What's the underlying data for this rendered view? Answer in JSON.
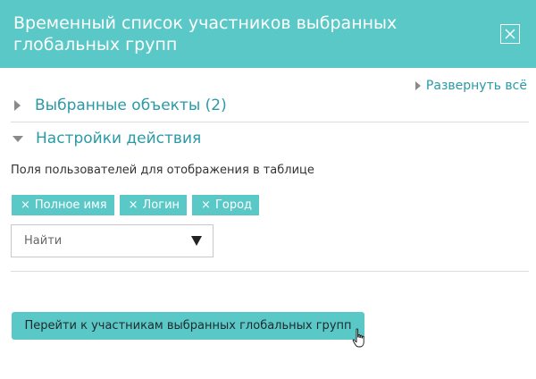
{
  "header": {
    "title": "Временный список участников выбранных глобальных групп"
  },
  "toolbar": {
    "expand_all_label": "Развернуть всё"
  },
  "sections": [
    {
      "label": "Выбранные объекты (2)",
      "expanded": false
    },
    {
      "label": "Настройки действия",
      "expanded": true
    }
  ],
  "settings": {
    "fields_label": "Поля пользователей для отображения в таблице",
    "tags": [
      {
        "label": "Полное имя"
      },
      {
        "label": "Логин"
      },
      {
        "label": "Город"
      }
    ],
    "tag_remove_glyph": "×",
    "search_placeholder": "Найти"
  },
  "actions": {
    "submit_label": "Перейти к участникам выбранных глобальных групп"
  },
  "colors": {
    "accent": "#5bc8c8",
    "link": "#2a9aa6"
  }
}
